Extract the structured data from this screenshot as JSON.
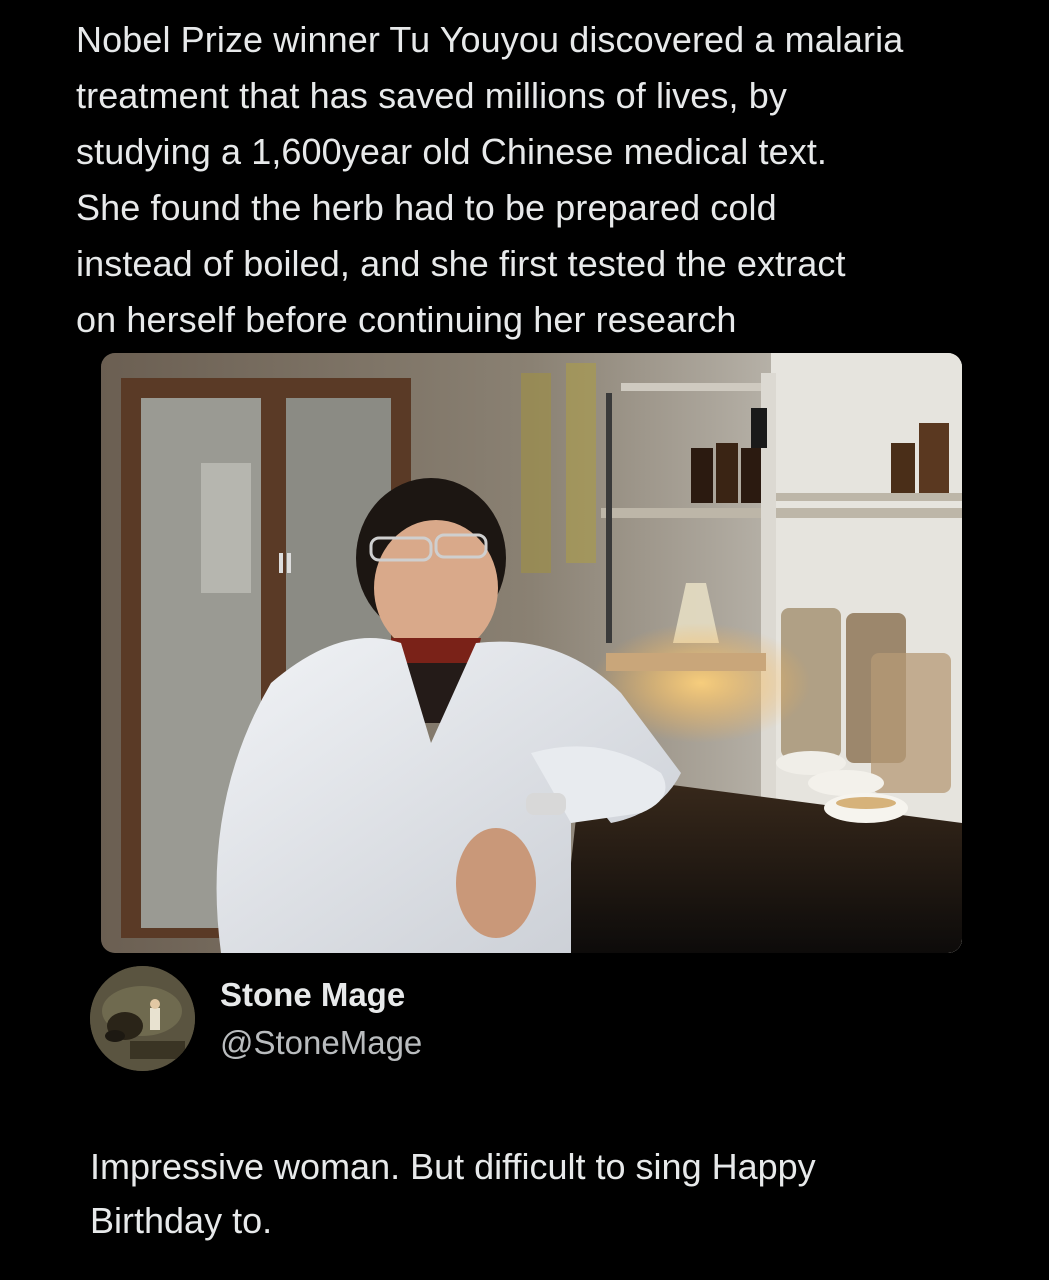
{
  "post": {
    "text_lines": [
      "Nobel Prize winner Tu Youyou discovered a malaria",
      "treatment that has saved millions of lives, by",
      "studying a 1,600year old Chinese medical text.",
      "She found the herb had to be prepared cold",
      "instead of boiled, and she first tested the extract",
      "on herself before continuing her research"
    ]
  },
  "photo": {
    "subject": "scientist in white lab coat seated at laboratory bench"
  },
  "author": {
    "display_name": "Stone Mage",
    "handle": "@StoneMage",
    "avatar_icon": "avatar-image"
  },
  "reply": {
    "text_lines": [
      "Impressive woman. But difficult to sing Happy",
      "Birthday to."
    ]
  },
  "colors": {
    "background": "#000000",
    "text": "#e7e9ea",
    "secondary_text": "#b9bcbe"
  }
}
